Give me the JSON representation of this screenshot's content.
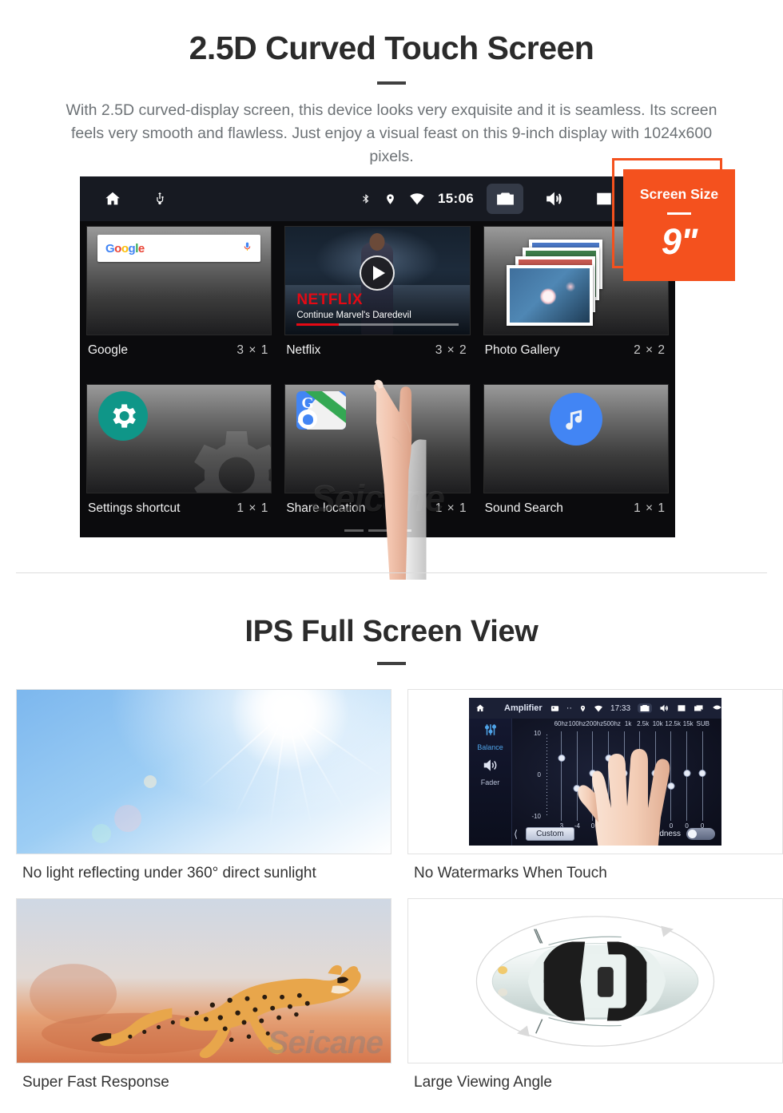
{
  "section1": {
    "title": "2.5D Curved Touch Screen",
    "lead": "With 2.5D curved-display screen, this device looks very exquisite and it is seamless. Its screen feels very smooth and flawless. Just enjoy a visual feast on this 9-inch display with 1024x600 pixels."
  },
  "badge": {
    "label": "Screen Size",
    "value": "9\"",
    "color": "#F4511E"
  },
  "device": {
    "statusbar": {
      "home_icon": "home-icon",
      "usb_icon": "usb-icon",
      "bluetooth_icon": "bluetooth-icon",
      "location_icon": "location-pin-icon",
      "wifi_icon": "wifi-icon",
      "clock": "15:06",
      "camera_icon": "camera-icon",
      "volume_icon": "volume-icon",
      "close_icon": "close-box-icon",
      "recents_icon": "recents-icon"
    },
    "widgets": [
      {
        "name": "Google",
        "size": "3 × 1",
        "icon": "google-search-widget"
      },
      {
        "name": "Netflix",
        "size": "3 × 2",
        "icon": "netflix-widget"
      },
      {
        "name": "Photo Gallery",
        "size": "2 × 2",
        "icon": "photo-stack-icon"
      },
      {
        "name": "Settings shortcut",
        "size": "1 × 1",
        "icon": "gear-icon"
      },
      {
        "name": "Share location",
        "size": "1 × 1",
        "icon": "google-maps-share-icon"
      },
      {
        "name": "Sound Search",
        "size": "1 × 1",
        "icon": "music-note-icon"
      }
    ],
    "google_widget": {
      "logo": "Google",
      "mic_icon": "microphone-icon"
    },
    "netflix_widget": {
      "brand": "NETFLIX",
      "subtitle": "Continue Marvel's Daredevil",
      "play_icon": "play-icon"
    },
    "watermark": "Seicane"
  },
  "section2": {
    "title": "IPS Full Screen View",
    "cards": [
      {
        "caption": "No light reflecting under 360° direct sunlight",
        "media": "sunlight-photo"
      },
      {
        "caption": "No Watermarks When Touch",
        "media": "amplifier-screenshot"
      },
      {
        "caption": "Super Fast Response",
        "media": "cheetah-photo"
      },
      {
        "caption": "Large Viewing Angle",
        "media": "car-top-view-illustration"
      }
    ]
  },
  "amplifier": {
    "home_icon": "home-icon",
    "title": "Amplifier",
    "gallery_icon": "gallery-icon",
    "dots_icon": "more-icon",
    "location_icon": "location-pin-icon",
    "wifi_icon": "wifi-icon",
    "clock": "17:33",
    "camera_icon": "camera-icon",
    "volume_icon": "volume-icon",
    "close_icon": "close-box-icon",
    "recents_icon": "recents-icon",
    "back_icon": "back-icon",
    "balance_label": "Balance",
    "fader_label": "Fader",
    "balance_icon": "sliders-icon",
    "fader_icon": "speaker-icon",
    "scale_top": "10",
    "scale_mid": "0",
    "scale_bottom": "-10",
    "bands": [
      "60hz",
      "100hz",
      "200hz",
      "500hz",
      "1k",
      "2.5k",
      "10k",
      "12.5k",
      "15k",
      "SUB"
    ],
    "values": [
      "3",
      "-4",
      "0",
      "0",
      "-3",
      "0",
      "-3",
      "0",
      "0",
      "0"
    ],
    "preset": "Custom",
    "loudness_label": "loudness",
    "back_arrow_icon": "chevron-left-icon"
  },
  "watermark": "Seicane"
}
